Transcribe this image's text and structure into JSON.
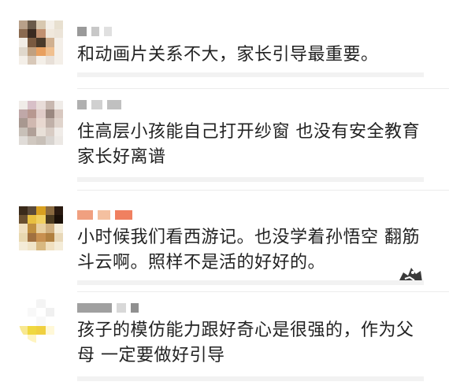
{
  "comments": [
    {
      "text": "和动画片关系不大，家长引导最重要。",
      "avatar_colors": [
        "#b8a08a",
        "#6a5a4a",
        "#d8c8b0",
        "#f4efe8",
        "#e8e0d0",
        "#8a6a50",
        "#3a2a20",
        "#c09070",
        "#f0e8dc",
        "#ece4d8",
        "#f2ede6",
        "#7a5a40",
        "#4a3a2a",
        "#d0b090",
        "#f4efe8",
        "#e0d8cc",
        "#c0a080",
        "#e8a060",
        "#f0c090",
        "#f4efe8",
        "#f4efe8",
        "#d8c8b8",
        "#f4efe8",
        "#e8e0d8",
        "#f4efe8"
      ],
      "name_colors": [
        "#9a9a9a",
        "#c8c8c8",
        "#e0e0e0"
      ]
    },
    {
      "text": "住高层小孩能自己打开纱窗 也没有安全教育 家长好离谱",
      "avatar_colors": [
        "#f0ece8",
        "#d8c0c8",
        "#e8dcd8",
        "#c8b8b0",
        "#f0ece8",
        "#c0a8a8",
        "#b89890",
        "#e0ccc8",
        "#9a8880",
        "#d8c8c0",
        "#a89890",
        "#d0b8b0",
        "#e8d8d0",
        "#c0b0a8",
        "#e0d4cc",
        "#c8c0b8",
        "#b0a098",
        "#e8e0d8",
        "#d8ccc4",
        "#f0ece8",
        "#e0dcd8",
        "#d0c8c0",
        "#c8c0b8",
        "#d8d4d0",
        "#ece8e4"
      ],
      "name_colors": [
        "#b0b0b0",
        "#d0d0d0",
        "#c0c0c0"
      ]
    },
    {
      "text": "小时候我们看西游记。也没学着孙悟空 翻筋斗云啊。照样不是活的好好的。",
      "avatar_colors": [
        "#3a2a1a",
        "#5a4a3a",
        "#d8a020",
        "#8a6a40",
        "#2a1a10",
        "#6a5030",
        "#e8c040",
        "#f0d060",
        "#4a3a20",
        "#1a1008",
        "#f0e0c0",
        "#c09040",
        "#e8d0a0",
        "#d0b080",
        "#f4ecd8",
        "#e8d8b0",
        "#a07040",
        "#c89050",
        "#b08040",
        "#e8d8b8",
        "#f4ecd8",
        "#f0e4c8",
        "#d8b880",
        "#f0e0c0",
        "#f4ecd8"
      ],
      "name_colors": [
        "#f0a080",
        "#f4c0a0",
        "#f08060"
      ]
    },
    {
      "text": "孩子的模仿能力跟好奇心是很强的，作为父母 一定要做好引导",
      "avatar_colors": [
        "#ffffff",
        "#ffffff",
        "#f4f4f4",
        "#ffffff",
        "#ffffff",
        "#ffffff",
        "#f8f8f8",
        "#ffffff",
        "#f0f0f0",
        "#ffffff",
        "#ffffff",
        "#ffffff",
        "#f8f8f8",
        "#ffffff",
        "#ffffff",
        "#f8e890",
        "#f0d840",
        "#f0d040",
        "#fff8d8",
        "#ffffff",
        "#ffffff",
        "#fff4c0",
        "#ffffff",
        "#ffffff",
        "#ffffff"
      ],
      "name_colors": [
        "#a0a0a0",
        "#d8d8d8",
        "#909090"
      ]
    }
  ]
}
